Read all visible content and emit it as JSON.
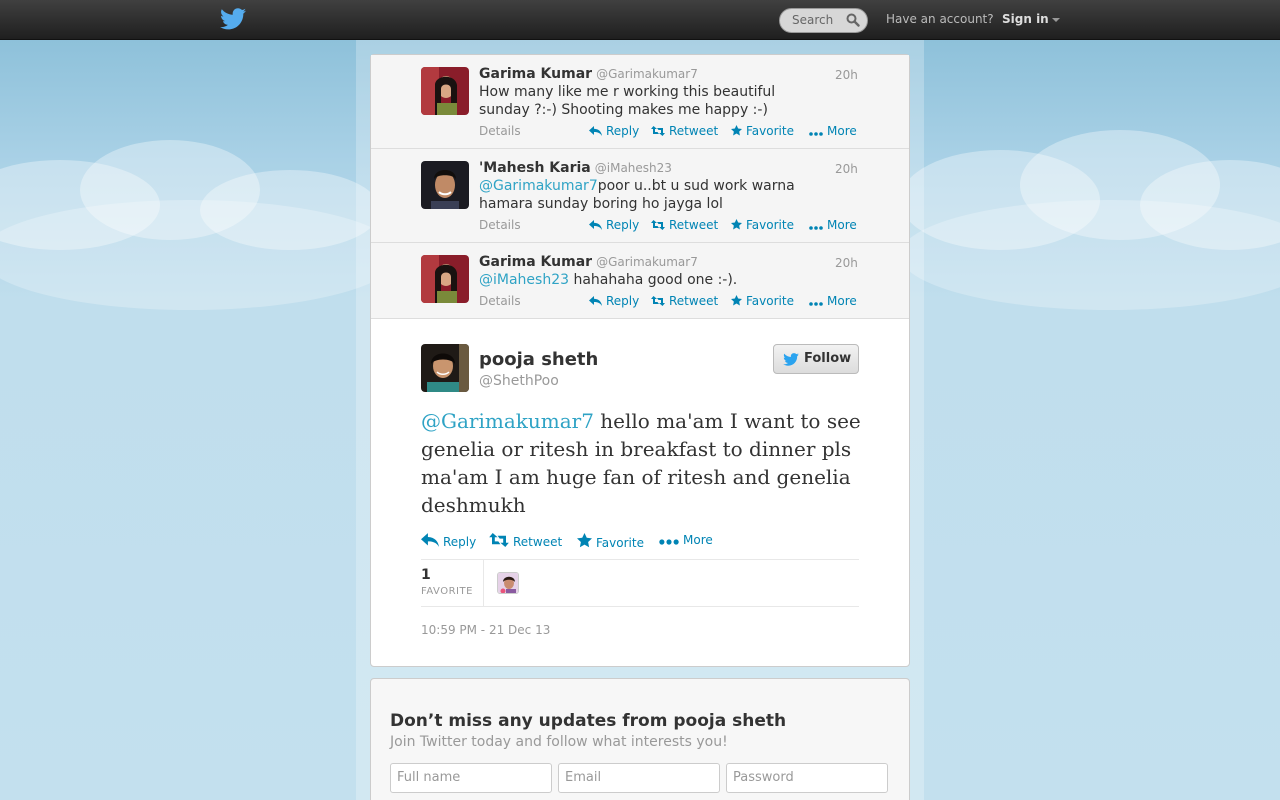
{
  "topbar": {
    "search_placeholder": "Search",
    "have_account": "Have an account?",
    "sign_in": "Sign in"
  },
  "conversation": [
    {
      "name": "Garima Kumar",
      "handle": "@Garimakumar7",
      "time": "20h",
      "mention": "",
      "text": "How many like me r working this beautiful sunday ?:-) Shooting makes me happy :-)",
      "details": "Details"
    },
    {
      "name": "'Mahesh Karia",
      "handle": "@iMahesh23",
      "time": "20h",
      "mention": "@Garimakumar7",
      "text": "poor u..bt u sud work warna hamara sunday boring ho jayga lol",
      "details": "Details"
    },
    {
      "name": "Garima Kumar",
      "handle": "@Garimakumar7",
      "time": "20h",
      "mention": "@iMahesh23",
      "text": " hahahaha good one :-).",
      "details": "Details"
    }
  ],
  "actions": {
    "reply": "Reply",
    "retweet": "Retweet",
    "favorite": "Favorite",
    "more": "More"
  },
  "main_tweet": {
    "name": "pooja sheth",
    "handle": "@ShethPoo",
    "follow": "Follow",
    "mention": "@Garimakumar7",
    "text": " hello ma'am I want to see genelia or ritesh in breakfast to dinner pls ma'am I am huge fan of ritesh and genelia deshmukh",
    "favorites_count": "1",
    "favorites_label": "FAVORITE",
    "timestamp": "10:59 PM - 21 Dec 13"
  },
  "signup": {
    "title": "Don’t miss any updates from pooja sheth",
    "subtitle": "Join Twitter today and follow what interests you!",
    "fullname_placeholder": "Full name",
    "email_placeholder": "Email",
    "password_placeholder": "Password"
  },
  "colors": {
    "link": "#0084b4",
    "mention": "#2fa3c5",
    "topbar": "#2b2b2b",
    "sky": "#c0deed",
    "bird": "#55acee"
  }
}
